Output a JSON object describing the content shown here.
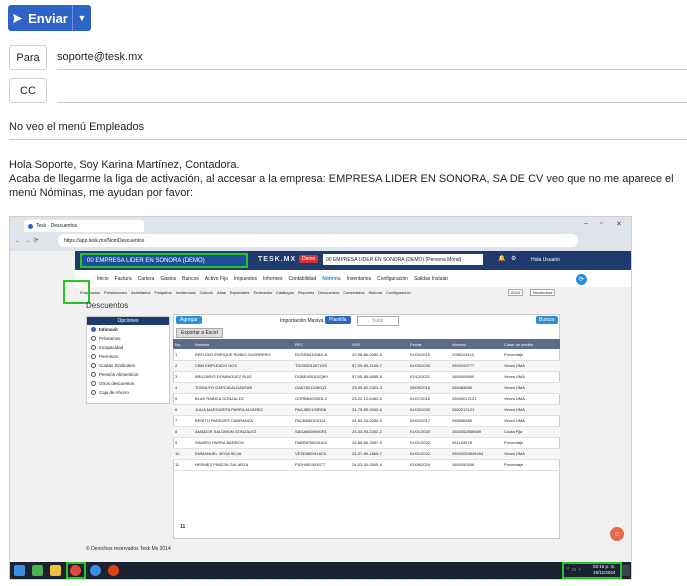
{
  "compose": {
    "send_label": "Enviar",
    "to_label": "Para",
    "to_value": "soporte@tesk.mx",
    "cc_label": "CC",
    "cc_value": "",
    "subject": "No veo el menú Empleados",
    "body": [
      "Hola Soporte, Soy Karina Martínez, Contadora.",
      "Acaba de llegarme la liga de activación, al accesar a la empresa: EMPRESA LIDER EN SONORA, SA DE CV veo que no me aparece el menú Nóminas, me ayudan por favor:"
    ]
  },
  "screenshot": {
    "browser": {
      "tab_title": "Tesk · Descuentos",
      "url": "https://app.tesk.mx/NomDescuentos"
    },
    "app": {
      "company_label": "00 EMPRESA LIDER EN SONORA (DEMO)",
      "brand": "TESK.MX",
      "mode_badge": "Demo",
      "company_select": "00 EMPRESA LIDER EN SONORA (DEMO) (Persona Moral)",
      "user": "Hola Usuario",
      "menu": [
        "Inicio",
        "Factura",
        "Cartera",
        "Gastos",
        "Bancos",
        "Activo Fijo",
        "Impuestos",
        "Informes",
        "Contabilidad",
        "Nómina",
        "Inventarios",
        "Configuración",
        "Salidas Instalar"
      ],
      "submenu": [
        "Empleados",
        "Prestaciones",
        "Asimilados",
        "Finiquitos",
        "Incidencias",
        "Cálculo",
        "Altas",
        "Especiales",
        "Timbrados",
        "Catálogos",
        "Reportes",
        "Descuentos",
        "Cancelados",
        "Historia",
        "Configuración"
      ],
      "year": "2024",
      "month": "Noviembre",
      "page_title": "Descuentos",
      "options_header": "Opciones",
      "options": [
        "Infonavit",
        "Préstamos",
        "Incapacidad",
        "Permisos",
        "Cuotas Sindicales",
        "Pensión Alimenticia",
        "Otros descuentos",
        "Caja de Ahorro"
      ],
      "add_button": "Agregar",
      "import_label": "Importación Masiva",
      "template_button": "Plantilla",
      "upload_button": "Subir",
      "search_button": "Buscar",
      "export_button": "Exportar a Excel",
      "columns": [
        "No.",
        "Nombre",
        "RFC",
        "NSS",
        "Fecha",
        "Número",
        "Clase de crédito"
      ],
      "rows": [
        [
          "1",
          "REFUGIO ENRIQUE RUBIO GUERRERO",
          "RUGR8410082LA",
          "22-98-86-0082-6",
          "01/03/2016",
          "2098104110",
          "Porcentaje"
        ],
        [
          "2",
          "CBM EMPLEADO DOS",
          "TDOE8312071H9",
          "57-09-83-2165-7",
          "01/03/2020",
          "2609153777",
          "Veces UMA"
        ],
        [
          "3",
          "BRUZARIO DOMINGUEZ RUIZ",
          "DOBE450102QB9",
          "57-05-85-6655-5",
          "01/12/2021",
          "2600009000",
          "Veces UMA"
        ],
        [
          "4",
          "TODULFO GARCIA ALGANTAR",
          "GAAT821118KQ3",
          "23-99-82-2423-4",
          "05/09/2016",
          "265465656",
          "Veces UMA"
        ],
        [
          "5",
          "BLAS RABICA GONZALEZ",
          "GORB8409303L3",
          "23-22-12-5482-5",
          "01/07/2016",
          "26000012121",
          "Veces UMA"
        ],
        [
          "6",
          "JULIA MARGARITA PARRA ALVAREZ",
          "PAAJ850109RD8",
          "24-79-85-0042-6",
          "01/03/2020",
          "2600212121",
          "Veces UMA"
        ],
        [
          "7",
          "BENITO PAREDES CARRANZA",
          "PACB850303114",
          "24-83-93-0280-0",
          "02/02/2017",
          "265656565",
          "Veces UMA"
        ],
        [
          "8",
          "AMADOR SALOMON GONZALEZ",
          "SAGA8809090R1",
          "24-03-93-2252-2",
          "01/01/2020",
          "2600052656989",
          "Cuota Fija"
        ],
        [
          "9",
          "RAMIRO PARRA BARRON",
          "PABR870823UG2",
          "24-85-86-3397-9",
          "01/01/2022",
          "26115457B",
          "Porcentaje"
        ],
        [
          "10",
          "EMMANUEL VEGA SILVA",
          "VESE8809116C5",
          "24-07-89-1665-7",
          "01/01/2022",
          "26000054545454",
          "Veces UMA"
        ],
        [
          "11",
          "HERMES PINZON GALARZA",
          "PIGH450303S77",
          "24-03-00-0545-4",
          "01/09/2024",
          "2600050056",
          "Porcentaje"
        ]
      ],
      "footer_count": "11",
      "copyright": "© Derechos reservados Tesk Mx 2014"
    },
    "taskbar": {
      "time": "02:15 p. m.",
      "date": "15/11/2024"
    }
  }
}
